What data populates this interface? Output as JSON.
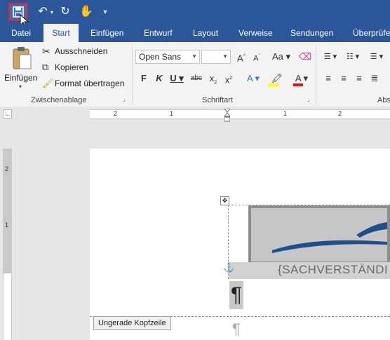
{
  "qat": {
    "more_label": "▾"
  },
  "tabs": [
    {
      "label": "Datei",
      "active": false
    },
    {
      "label": "Start",
      "active": true
    },
    {
      "label": "Einfügen",
      "active": false
    },
    {
      "label": "Entwurf",
      "active": false
    },
    {
      "label": "Layout",
      "active": false
    },
    {
      "label": "Verweise",
      "active": false
    },
    {
      "label": "Sendungen",
      "active": false
    },
    {
      "label": "Überprüfen",
      "active": false
    }
  ],
  "clipboard": {
    "paste_label": "Einfügen",
    "cut_label": "Ausschneiden",
    "copy_label": "Kopieren",
    "format_painter_label": "Format übertragen",
    "group_label": "Zwischenablage"
  },
  "font": {
    "font_name": "Open Sans",
    "font_size": "",
    "group_label": "Schriftart"
  },
  "paragraph": {
    "group_label": "Abs"
  },
  "ruler": {
    "h_ticks": [
      "2",
      "1",
      "1",
      "2"
    ],
    "v_ticks": [
      "2",
      "1"
    ]
  },
  "document": {
    "header_label": "Ungerade Kopfzeile",
    "placeholder_text": "{SACHVERSTÄNDI",
    "pilcrow": "¶"
  },
  "colors": {
    "accent": "#2b579a",
    "highlight_yellow": "#ffff00",
    "font_red": "#e81123",
    "save_outline": "#e0242a"
  }
}
